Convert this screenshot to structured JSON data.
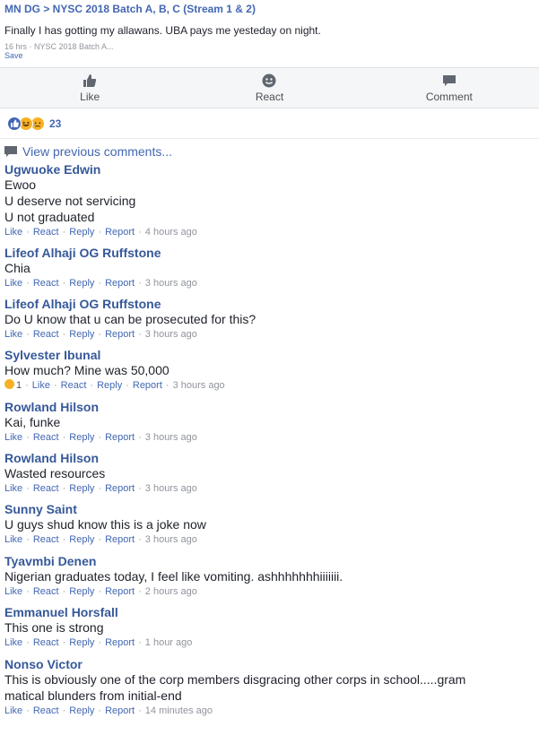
{
  "post": {
    "title": "MN DG > NYSC 2018 Batch A, B, C (Stream 1 & 2)",
    "text": "Finally I has gotting my allawans. UBA pays me yesteday on night.",
    "meta": "16 hrs · NYSC 2018 Batch A...",
    "save_label": "Save"
  },
  "actions": {
    "like": "Like",
    "react": "React",
    "comment": "Comment"
  },
  "reactions": {
    "count": "23"
  },
  "view_previous": "View previous comments...",
  "labels": {
    "like": "Like",
    "react": "React",
    "reply": "Reply",
    "report": "Report",
    "sep": "·"
  },
  "comments": [
    {
      "author": "Ugwuoke Edwin",
      "lines": [
        "Ewoo",
        "U deserve not servicing",
        "U not graduated"
      ],
      "time": "4 hours ago"
    },
    {
      "author": "Lifeof Alhaji OG Ruffstone",
      "lines": [
        "Chia"
      ],
      "time": "3 hours ago"
    },
    {
      "author": "Lifeof Alhaji OG Ruffstone",
      "lines": [
        "Do U know that u can be prosecuted for this?"
      ],
      "time": "3 hours ago"
    },
    {
      "author": "Sylvester Ibunal",
      "lines": [
        "How much? Mine was 50,000"
      ],
      "time": "3 hours ago",
      "reaction_count": "1"
    },
    {
      "author": "Rowland Hilson",
      "lines": [
        "Kai, funke"
      ],
      "time": "3 hours ago"
    },
    {
      "author": "Rowland Hilson",
      "lines": [
        "Wasted resources"
      ],
      "time": "3 hours ago"
    },
    {
      "author": "Sunny Saint",
      "lines": [
        "U guys shud know this is a joke now"
      ],
      "time": "3 hours ago"
    },
    {
      "author": "Tyavmbi Denen",
      "lines": [
        "Nigerian graduates today, I feel like vomiting. ashhhhhhhiiiiiii."
      ],
      "time": "2 hours ago"
    },
    {
      "author": "Emmanuel Horsfall",
      "lines": [
        "This one is strong"
      ],
      "time": "1 hour ago"
    },
    {
      "author": "Nonso Victor",
      "lines": [
        "This is obviously one of the corp members disgracing other corps in school.....gram",
        "matical blunders from initial-end"
      ],
      "time": "14 minutes ago"
    }
  ],
  "colors": {
    "link": "#4267b2",
    "author": "#365899",
    "muted": "#90949c",
    "bar": "#f5f6f7"
  },
  "icons": [
    "like-icon",
    "react-icon",
    "comment-icon",
    "comment-bubble-icon",
    "haha-emoji-icon",
    "sad-emoji-icon"
  ]
}
